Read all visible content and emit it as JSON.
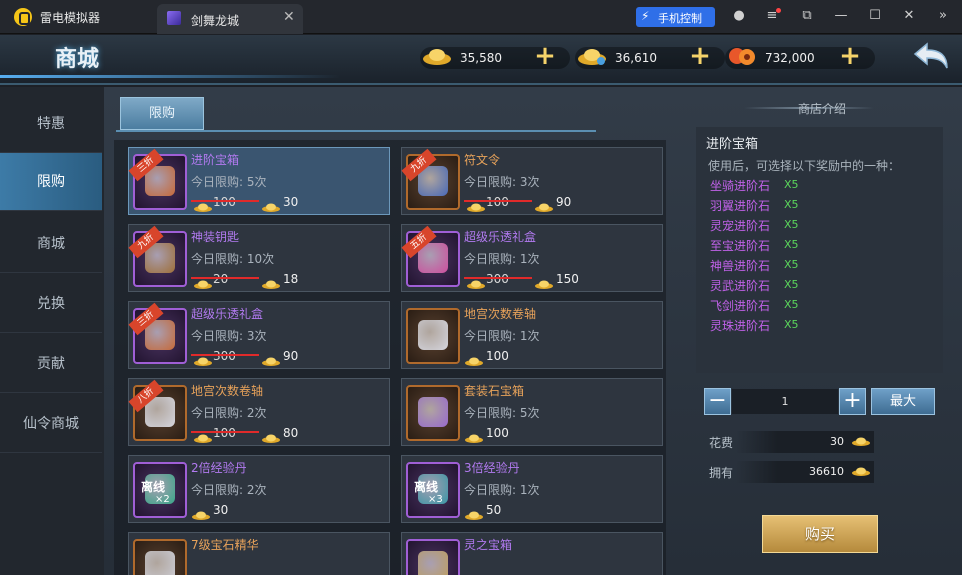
{
  "emulator": {
    "name": "雷电模拟器",
    "tab_title": "剑舞龙城",
    "phone_control": "手机控制"
  },
  "header": {
    "title": "商城"
  },
  "currencies": [
    {
      "name": "gold-ingot",
      "value": "35,580"
    },
    {
      "name": "bound-ingot",
      "value": "36,610"
    },
    {
      "name": "copper-coins",
      "value": "732,000"
    }
  ],
  "sidebar": {
    "items": [
      "特惠",
      "限购",
      "商城",
      "兑换",
      "贡献",
      "仙令商城"
    ],
    "active_index": 1
  },
  "subtab": "限购",
  "items": [
    {
      "name": "进阶宝箱",
      "limit": "今日限购: 5次",
      "orig": "100",
      "price": "30",
      "ribbon": "三折",
      "color": "purple"
    },
    {
      "name": "符文令",
      "limit": "今日限购: 3次",
      "orig": "100",
      "price": "90",
      "ribbon": "九折",
      "color": "orange"
    },
    {
      "name": "神装钥匙",
      "limit": "今日限购: 10次",
      "orig": "20",
      "price": "18",
      "ribbon": "九折",
      "color": "purple"
    },
    {
      "name": "超级乐透礼盒",
      "limit": "今日限购: 1次",
      "orig": "300",
      "price": "150",
      "ribbon": "五折",
      "color": "purple"
    },
    {
      "name": "超级乐透礼盒",
      "limit": "今日限购: 3次",
      "orig": "300",
      "price": "90",
      "ribbon": "三折",
      "color": "purple"
    },
    {
      "name": "地宫次数卷轴",
      "limit": "今日限购: 1次",
      "orig": "",
      "price": "100",
      "ribbon": "",
      "color": "orange"
    },
    {
      "name": "地宫次数卷轴",
      "limit": "今日限购: 2次",
      "orig": "100",
      "price": "80",
      "ribbon": "八折",
      "color": "orange"
    },
    {
      "name": "套装石宝箱",
      "limit": "今日限购: 5次",
      "orig": "",
      "price": "100",
      "ribbon": "",
      "color": "orange"
    },
    {
      "name": "2倍经验丹",
      "limit": "今日限购: 2次",
      "orig": "",
      "price": "30",
      "ribbon": "",
      "color": "purple",
      "badge": "离线",
      "mult": "×2"
    },
    {
      "name": "3倍经验丹",
      "limit": "今日限购: 1次",
      "orig": "",
      "price": "50",
      "ribbon": "",
      "color": "purple",
      "badge": "离线",
      "mult": "×3"
    },
    {
      "name": "7级宝石精华",
      "limit": "",
      "orig": "",
      "price": "",
      "ribbon": "",
      "color": "orange"
    },
    {
      "name": "灵之宝箱",
      "limit": "",
      "orig": "",
      "price": "",
      "ribbon": "",
      "color": "purple"
    }
  ],
  "intro_label": "商店介绍",
  "detail": {
    "title": "进阶宝箱",
    "desc": "使用后，可选择以下奖励中的一种：",
    "rewards": [
      {
        "name": "坐骑进阶石",
        "count": "X5"
      },
      {
        "name": "羽翼进阶石",
        "count": "X5"
      },
      {
        "name": "灵宠进阶石",
        "count": "X5"
      },
      {
        "name": "至宝进阶石",
        "count": "X5"
      },
      {
        "name": "神兽进阶石",
        "count": "X5"
      },
      {
        "name": "灵武进阶石",
        "count": "X5"
      },
      {
        "name": "飞剑进阶石",
        "count": "X5"
      },
      {
        "name": "灵珠进阶石",
        "count": "X5"
      }
    ]
  },
  "purchase": {
    "qty": "1",
    "max_label": "最大",
    "cost_label": "花费",
    "cost": "30",
    "own_label": "拥有",
    "own": "36610",
    "buy_label": "购买"
  }
}
